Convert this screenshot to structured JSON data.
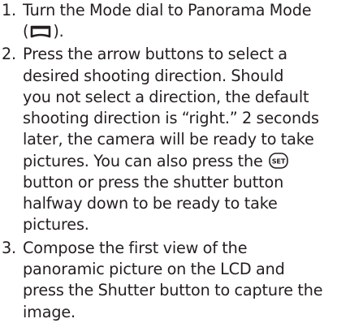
{
  "steps": [
    {
      "number": "1.",
      "lines": [
        "Turn the Mode dial to Panorama Mode",
        [
          "(",
          "panorama-mode-icon",
          ")."
        ]
      ]
    },
    {
      "number": "2.",
      "lines": [
        "Press the arrow buttons to select a",
        "desired shooting direction. Should",
        "you not select a direction, the default",
        "shooting direction is “right.” 2 seconds",
        "later, the camera will be ready to take",
        [
          "pictures. You can also press the ",
          "set-button-icon",
          ""
        ],
        "button or press the shutter button",
        "halfway down to be ready to take",
        "pictures."
      ]
    },
    {
      "number": "3.",
      "lines": [
        "Compose the first view of the",
        "panoramic picture on the LCD and",
        "press the Shutter button to capture the",
        "image."
      ]
    }
  ],
  "icons": {
    "panorama": "panorama-mode-icon",
    "set": "set-button-icon",
    "set_text": "SET"
  }
}
